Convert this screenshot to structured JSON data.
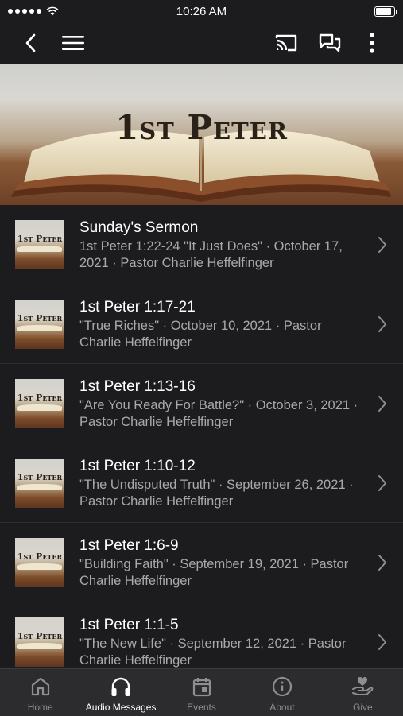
{
  "status_bar": {
    "time": "10:26 AM"
  },
  "hero": {
    "title": "1st Peter"
  },
  "messages": [
    {
      "thumb_text": "1st Peter",
      "title": "Sunday's Sermon",
      "subtitle": "1st Peter 1:22-24 \"It Just Does\" · October 17, 2021 · Pastor Charlie Heffelfinger"
    },
    {
      "thumb_text": "1st Peter",
      "title": "1st Peter 1:17-21",
      "subtitle": "\"True Riches\" · October 10, 2021 · Pastor Charlie Heffelfinger"
    },
    {
      "thumb_text": "1st Peter",
      "title": "1st Peter 1:13-16",
      "subtitle": "\"Are You Ready For Battle?\" · October 3, 2021 · Pastor Charlie Heffelfinger"
    },
    {
      "thumb_text": "1st Peter",
      "title": "1st Peter 1:10-12",
      "subtitle": "\"The Undisputed Truth\" · September 26, 2021 · Pastor Charlie Heffelfinger"
    },
    {
      "thumb_text": "1st Peter",
      "title": "1st Peter 1:6-9",
      "subtitle": "\"Building Faith\" · September 19, 2021 · Pastor Charlie Heffelfinger"
    },
    {
      "thumb_text": "1st Peter",
      "title": "1st Peter 1:1-5",
      "subtitle": "\"The New Life\" · September 12, 2021 · Pastor Charlie Heffelfinger"
    }
  ],
  "tabs": [
    {
      "label": "Home",
      "icon": "home-icon",
      "active": false
    },
    {
      "label": "Audio Messages",
      "icon": "headphones-icon",
      "active": true
    },
    {
      "label": "Events",
      "icon": "calendar-icon",
      "active": false
    },
    {
      "label": "About",
      "icon": "info-icon",
      "active": false
    },
    {
      "label": "Give",
      "icon": "give-heart-hand-icon",
      "active": false
    }
  ],
  "colors": {
    "background": "#1c1c1e",
    "tab_bar": "#2c2c2e",
    "subtitle": "#a9a9ad",
    "inactive_tab": "#8e8e93"
  }
}
